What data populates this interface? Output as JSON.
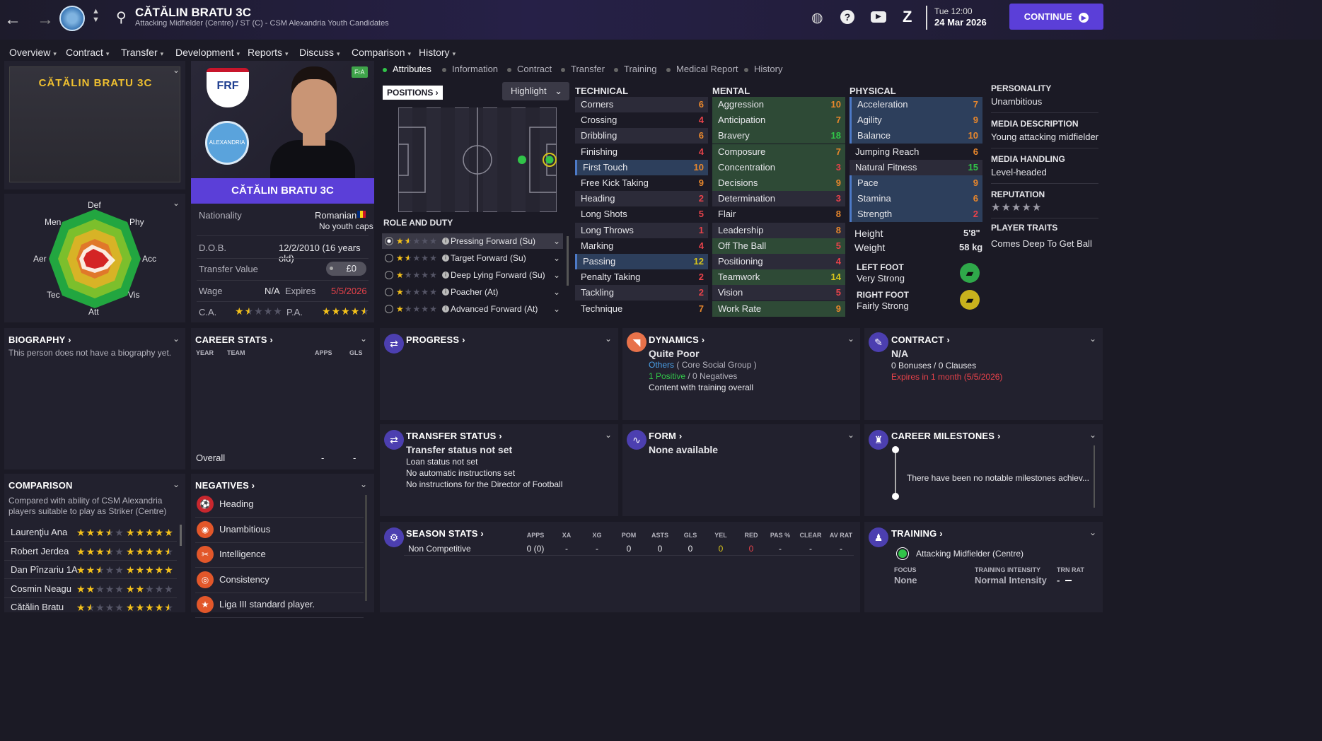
{
  "header": {
    "player_name": "CĂTĂLIN BRATU 3C",
    "subtitle": "Attacking Midfielder (Centre) / ST (C) - CSM Alexandria Youth Candidates",
    "day_time": "Tue 12:00",
    "date": "24 Mar 2026",
    "continue_label": "CONTINUE"
  },
  "nav": [
    "Overview",
    "Contract",
    "Transfer",
    "Development",
    "Reports",
    "Discuss",
    "Comparison",
    "History"
  ],
  "profile_card": {
    "name": "CĂTĂLIN BRATU 3C",
    "badge": "FrA",
    "frf": "FRF",
    "club": "ALEXANDRIA",
    "nationality_label": "Nationality",
    "nationality": "Romanian",
    "youth_caps": "No youth caps",
    "dob_label": "D.O.B.",
    "dob": "12/2/2010 (16 years old)",
    "value_label": "Transfer Value",
    "value": "£0",
    "wage_label": "Wage",
    "wage": "N/A",
    "expires_label": "Expires",
    "expires": "5/5/2026",
    "ca_label": "C.A.",
    "pa_label": "P.A.",
    "ca_stars": 1.5,
    "pa_stars": 4.5
  },
  "radar": {
    "labels": [
      "Def",
      "Phy",
      "Acc",
      "Vis",
      "Att",
      "Tec",
      "Aer",
      "Men"
    ]
  },
  "attr_tabs": [
    "Attributes",
    "Information",
    "Contract",
    "Transfer",
    "Training",
    "Medical Report",
    "History"
  ],
  "positions": {
    "label": "POSITIONS",
    "highlight": "Highlight"
  },
  "role_duty": {
    "label": "ROLE AND DUTY",
    "roles": [
      {
        "name": "Pressing Forward (Su)",
        "stars": 1.5
      },
      {
        "name": "Target Forward (Su)",
        "stars": 1.5
      },
      {
        "name": "Deep Lying Forward (Su)",
        "stars": 1
      },
      {
        "name": "Poacher (At)",
        "stars": 1
      },
      {
        "name": "Advanced Forward (At)",
        "stars": 1
      }
    ]
  },
  "technical": {
    "label": "TECHNICAL",
    "items": [
      [
        "Corners",
        "6"
      ],
      [
        "Crossing",
        "4"
      ],
      [
        "Dribbling",
        "6"
      ],
      [
        "Finishing",
        "4"
      ],
      [
        "First Touch",
        "10"
      ],
      [
        "Free Kick Taking",
        "9"
      ],
      [
        "Heading",
        "2"
      ],
      [
        "Long Shots",
        "5"
      ],
      [
        "Long Throws",
        "1"
      ],
      [
        "Marking",
        "4"
      ],
      [
        "Passing",
        "12"
      ],
      [
        "Penalty Taking",
        "2"
      ],
      [
        "Tackling",
        "2"
      ],
      [
        "Technique",
        "7"
      ]
    ]
  },
  "mental": {
    "label": "MENTAL",
    "items": [
      [
        "Aggression",
        "10"
      ],
      [
        "Anticipation",
        "7"
      ],
      [
        "Bravery",
        "18"
      ],
      [
        "Composure",
        "7"
      ],
      [
        "Concentration",
        "3"
      ],
      [
        "Decisions",
        "9"
      ],
      [
        "Determination",
        "3"
      ],
      [
        "Flair",
        "8"
      ],
      [
        "Leadership",
        "8"
      ],
      [
        "Off The Ball",
        "5"
      ],
      [
        "Positioning",
        "4"
      ],
      [
        "Teamwork",
        "14"
      ],
      [
        "Vision",
        "5"
      ],
      [
        "Work Rate",
        "9"
      ]
    ]
  },
  "physical": {
    "label": "PHYSICAL",
    "items": [
      [
        "Acceleration",
        "7"
      ],
      [
        "Agility",
        "9"
      ],
      [
        "Balance",
        "10"
      ],
      [
        "Jumping Reach",
        "6"
      ],
      [
        "Natural Fitness",
        "15"
      ],
      [
        "Pace",
        "9"
      ],
      [
        "Stamina",
        "6"
      ],
      [
        "Strength",
        "2"
      ]
    ],
    "height_label": "Height",
    "height": "5'8\"",
    "weight_label": "Weight",
    "weight": "58 kg",
    "left_foot_label": "LEFT FOOT",
    "left_foot": "Very Strong",
    "right_foot_label": "RIGHT FOOT",
    "right_foot": "Fairly Strong"
  },
  "personality": {
    "label": "PERSONALITY",
    "value": "Unambitious",
    "media_desc_label": "MEDIA DESCRIPTION",
    "media_desc": "Young attacking midfielder",
    "media_handling_label": "MEDIA HANDLING",
    "media_handling": "Level-headed",
    "reputation_label": "REPUTATION",
    "traits_label": "PLAYER TRAITS",
    "traits": "Comes Deep To Get Ball"
  },
  "biography": {
    "label": "BIOGRAPHY",
    "text": "This person does not have a biography yet."
  },
  "career_stats": {
    "label": "CAREER STATS",
    "cols": [
      "YEAR",
      "TEAM",
      "APPS",
      "GLS"
    ],
    "overall": "Overall",
    "apps": "-",
    "gls": "-"
  },
  "comparison": {
    "label": "COMPARISON",
    "desc": "Compared with ability of CSM Alexandria players suitable to play as Striker (Centre)",
    "players": [
      {
        "name": "Laurenţiu Ana",
        "ca": 3.5,
        "pa": 5
      },
      {
        "name": "Robert Jerdea",
        "ca": 3.5,
        "pa": 4.5
      },
      {
        "name": "Dan Pînzariu 1A",
        "ca": 2.5,
        "pa": 5
      },
      {
        "name": "Cosmin Neagu",
        "ca": 2,
        "pa": 2
      },
      {
        "name": "Cătălin Bratu",
        "ca": 1.5,
        "pa": 4.5
      }
    ]
  },
  "negatives": {
    "label": "NEGATIVES",
    "items": [
      "Heading",
      "Unambitious",
      "Intelligence",
      "Consistency",
      "Liga III standard player."
    ]
  },
  "progress": {
    "label": "PROGRESS"
  },
  "dynamics": {
    "label": "DYNAMICS",
    "status": "Quite Poor",
    "group": "Others",
    "group_suffix": "( Core Social Group )",
    "positive": "1 Positive",
    "negatives": "0 Negatives",
    "content": "Content with training overall"
  },
  "contract": {
    "label": "CONTRACT",
    "value": "N/A",
    "bonuses": "0 Bonuses / 0 Clauses",
    "expires": "Expires in 1 month (5/5/2026)"
  },
  "transfer_status": {
    "label": "TRANSFER STATUS",
    "title": "Transfer status not set",
    "lines": [
      "Loan status not set",
      "No automatic instructions set",
      "No instructions for the Director of Football"
    ]
  },
  "form": {
    "label": "FORM",
    "value": "None available"
  },
  "milestones": {
    "label": "CAREER MILESTONES",
    "text": "There have been no notable milestones achiev..."
  },
  "season_stats": {
    "label": "SEASON STATS",
    "cols": [
      "APPS",
      "XA",
      "XG",
      "POM",
      "ASTS",
      "GLS",
      "YEL",
      "RED",
      "PAS %",
      "CLEAR",
      "AV RAT"
    ],
    "row_label": "Non Competitive",
    "values": [
      "0 (0)",
      "-",
      "-",
      "0",
      "0",
      "0",
      "0",
      "0",
      "-",
      "-",
      "-"
    ]
  },
  "training": {
    "label": "TRAINING",
    "role": "Attacking Midfielder (Centre)",
    "focus_label": "FOCUS",
    "focus": "None",
    "intensity_label": "TRAINING INTENSITY",
    "intensity": "Normal Intensity",
    "trn_rat_label": "TRN RAT",
    "trn_rat": "-"
  }
}
